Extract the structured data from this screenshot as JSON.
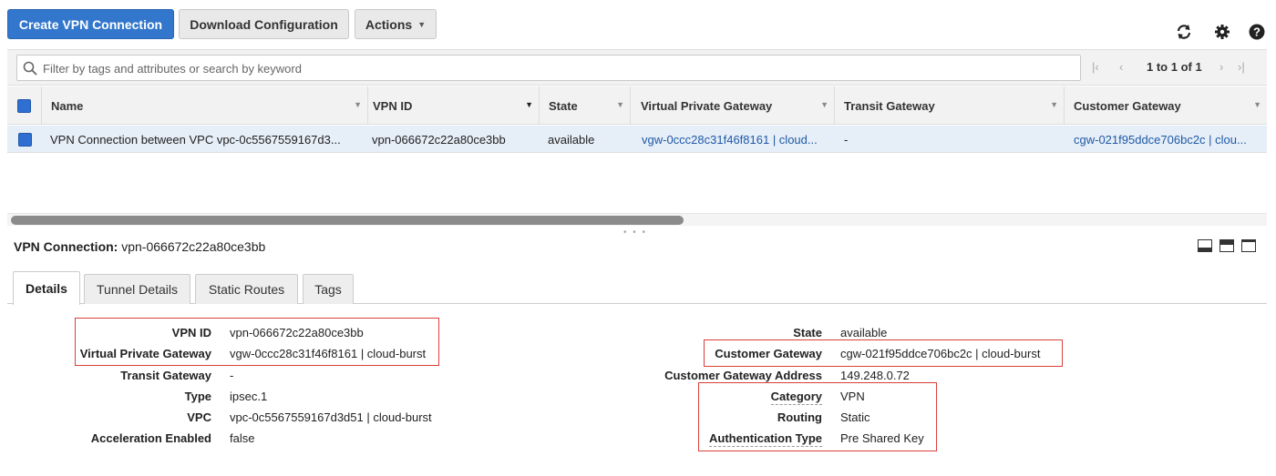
{
  "toolbar": {
    "create_label": "Create VPN Connection",
    "download_label": "Download Configuration",
    "actions_label": "Actions"
  },
  "filter": {
    "placeholder": "Filter by tags and attributes or search by keyword",
    "pager_text": "1 to 1 of 1"
  },
  "table": {
    "columns": [
      "Name",
      "VPN ID",
      "State",
      "Virtual Private Gateway",
      "Transit Gateway",
      "Customer Gateway"
    ],
    "rows": [
      {
        "name": "VPN Connection between VPC vpc-0c5567559167d3...",
        "vpn_id": "vpn-066672c22a80ce3bb",
        "state": "available",
        "vgw": "vgw-0ccc28c31f46f8161 | cloud...",
        "tgw": "-",
        "cgw": "cgw-021f95ddce706bc2c | clou..."
      }
    ]
  },
  "details": {
    "title_label": "VPN Connection:",
    "title_value": "vpn-066672c22a80ce3bb",
    "tabs": [
      "Details",
      "Tunnel Details",
      "Static Routes",
      "Tags"
    ],
    "left": [
      {
        "label": "VPN ID",
        "value": "vpn-066672c22a80ce3bb"
      },
      {
        "label": "Virtual Private Gateway",
        "value": "vgw-0ccc28c31f46f8161 | cloud-burst"
      },
      {
        "label": "Transit Gateway",
        "value": "-"
      },
      {
        "label": "Type",
        "value": "ipsec.1"
      },
      {
        "label": "VPC",
        "value": "vpc-0c5567559167d3d51 | cloud-burst"
      },
      {
        "label": "Acceleration Enabled",
        "value": "false"
      }
    ],
    "right": [
      {
        "label": "State",
        "value": "available"
      },
      {
        "label": "Customer Gateway",
        "value": "cgw-021f95ddce706bc2c | cloud-burst"
      },
      {
        "label": "Customer Gateway Address",
        "value": "149.248.0.72"
      },
      {
        "label": "Category",
        "value": "VPN"
      },
      {
        "label": "Routing",
        "value": "Static"
      },
      {
        "label": "Authentication Type",
        "value": "Pre Shared Key"
      }
    ]
  },
  "colors": {
    "primary": "#3377cc",
    "link": "#1f5aa6",
    "highlight_box": "#d9403a",
    "selected_row": "#e6eef8"
  },
  "icons": [
    "refresh-icon",
    "gear-icon",
    "help-icon",
    "search-icon",
    "first-page-icon",
    "prev-page-icon",
    "next-page-icon",
    "last-page-icon"
  ]
}
